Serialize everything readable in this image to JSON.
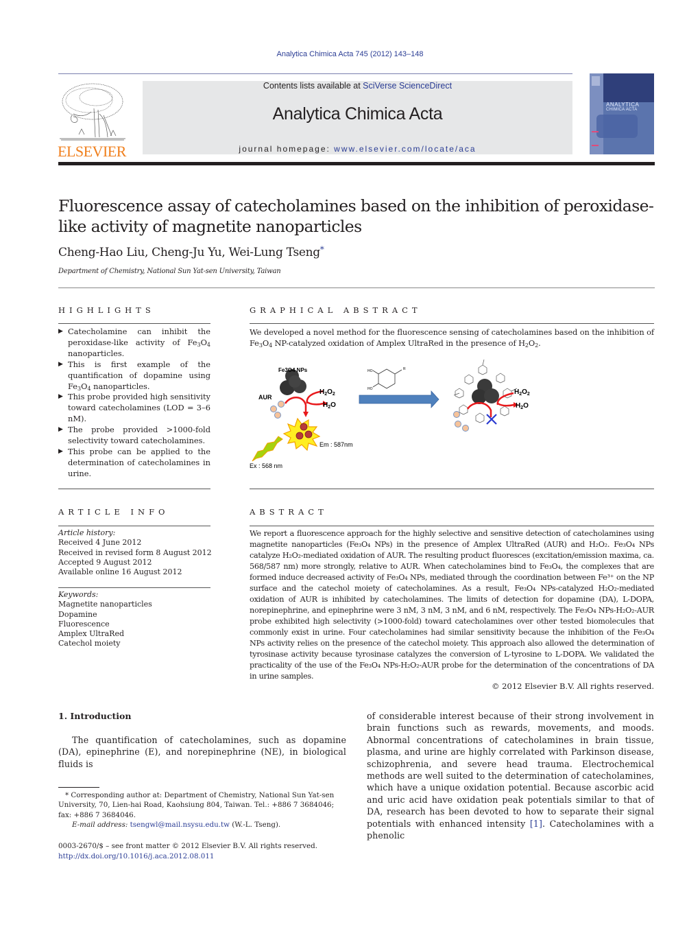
{
  "header": {
    "journal_ref": "Analytica Chimica Acta 745 (2012) 143–148",
    "contents_prefix": "Contents lists available at ",
    "contents_link": "SciVerse ScienceDirect",
    "journal_title": "Analytica Chimica Acta",
    "homepage_prefix": "journal homepage: ",
    "homepage_link": "www.elsevier.com/locate/aca",
    "publisher_logo_text": "ELSEVIER",
    "cover_title_line1": "ANALYTICA",
    "cover_title_line2": "CHIMICA ACTA"
  },
  "article": {
    "title": "Fluorescence assay of catecholamines based on the inhibition of peroxidase-like activity of magnetite nanoparticles",
    "authors": "Cheng-Hao Liu, Cheng-Ju Yu, Wei-Lung Tseng",
    "corresponding_mark": "*",
    "affiliation": "Department of Chemistry, National Sun Yat-sen University, Taiwan"
  },
  "highlights": {
    "heading": "HIGHLIGHTS",
    "items": [
      {
        "pre": "Catecholamine can inhibit the peroxidase-like activity of Fe",
        "s1": "3",
        "mid": "O",
        "s2": "4",
        "post": " nanoparticles."
      },
      {
        "pre": "This is first example of the quantification of dopamine using Fe",
        "s1": "3",
        "mid": "O",
        "s2": "4",
        "post": " nanoparticles."
      },
      {
        "pre": "This probe provided high sensitivity toward catecholamines (LOD = 3–6 nM).",
        "s1": "",
        "mid": "",
        "s2": "",
        "post": ""
      },
      {
        "pre": "The probe provided >1000-fold selectivity toward catecholamines.",
        "s1": "",
        "mid": "",
        "s2": "",
        "post": ""
      },
      {
        "pre": "This probe can be applied to the determination of catecholamines in urine.",
        "s1": "",
        "mid": "",
        "s2": "",
        "post": ""
      }
    ]
  },
  "graphical_abstract": {
    "heading": "GRAPHICAL ABSTRACT",
    "text_a": "We developed a novel method for the fluorescence sensing of catecholamines based on the inhibition of Fe",
    "text_b": " NP-catalyzed oxidation of Amplex UltraRed in the presence of H",
    "text_c": ".",
    "figure": {
      "np_label": "Fe3O4 NPs",
      "aur_label": "AUR",
      "h2o2_label": "H2O2",
      "h2o_label": "H2O",
      "em_label": "Em : 587nm",
      "ex_label": "Ex : 568 nm",
      "catechol_ho1": "HO",
      "catechol_ho2": "HO",
      "catechol_r": "R"
    }
  },
  "article_info": {
    "heading": "ARTICLE INFO",
    "history_label": "Article history:",
    "history": [
      "Received 4 June 2012",
      "Received in revised form 8 August 2012",
      "Accepted 9 August 2012",
      "Available online 16 August 2012"
    ],
    "keywords_label": "Keywords:",
    "keywords": [
      "Magnetite nanoparticles",
      "Dopamine",
      "Fluorescence",
      "Amplex UltraRed",
      "Catechol moiety"
    ]
  },
  "abstract": {
    "heading": "ABSTRACT",
    "text": "We report a fluorescence approach for the highly selective and sensitive detection of catecholamines using magnetite nanoparticles (Fe₃O₄ NPs) in the presence of Amplex UltraRed (AUR) and H₂O₂. Fe₃O₄ NPs catalyze H₂O₂-mediated oxidation of AUR. The resulting product fluoresces (excitation/emission maxima, ca. 568/587 nm) more strongly, relative to AUR. When catecholamines bind to Fe₃O₄, the complexes that are formed induce decreased activity of Fe₃O₄ NPs, mediated through the coordination between Fe³⁺ on the NP surface and the catechol moiety of catecholamines. As a result, Fe₃O₄ NPs-catalyzed H₂O₂-mediated oxidation of AUR is inhibited by catecholamines. The limits of detection for dopamine (DA), L-DOPA, norepinephrine, and epinephrine were 3 nM, 3 nM, 3 nM, and 6 nM, respectively. The Fe₃O₄ NPs-H₂O₂-AUR probe exhibited high selectivity (>1000-fold) toward catecholamines over other tested biomolecules that commonly exist in urine. Four catecholamines had similar sensitivity because the inhibition of the Fe₃O₄ NPs activity relies on the presence of the catechol moiety. This approach also allowed the determination of tyrosinase activity because tyrosinase catalyzes the conversion of L-tyrosine to L-DOPA. We validated the practicality of the use of the Fe₃O₄ NPs-H₂O₂-AUR probe for the determination of the concentrations of DA in urine samples.",
    "copyright": "© 2012 Elsevier B.V. All rights reserved."
  },
  "introduction": {
    "heading": "1.  Introduction",
    "para1": "The quantification of catecholamines, such as dopamine (DA), epinephrine (E), and norepinephrine (NE), in biological fluids is",
    "para2_pre": "of considerable interest because of their strong involvement in brain functions such as rewards, movements, and moods. Abnormal concentrations of catecholamines in brain tissue, plasma, and urine are highly correlated with Parkinson disease, schizophrenia, and severe head trauma. Electrochemical methods are well suited to the determination of catecholamines, which have a unique oxidation potential. Because ascorbic acid and uric acid have oxidation peak potentials similar to that of DA, research has been devoted to how to separate their signal potentials with enhanced intensity ",
    "para2_ref": "[1]",
    "para2_post": ". Catecholamines with a phenolic"
  },
  "footnote": {
    "corresponding": "* Corresponding author at: Department of Chemistry, National Sun Yat-sen University, 70, Lien-hai Road, Kaohsiung 804, Taiwan. Tel.: +886 7 3684046; fax: +886 7 3684046.",
    "email_label": "E-mail address: ",
    "email": "tsengwl@mail.nsysu.edu.tw",
    "email_suffix": " (W.-L. Tseng).",
    "front_matter": "0003-2670/$ – see front matter © 2012 Elsevier B.V. All rights reserved.",
    "doi": "http://dx.doi.org/10.1016/j.aca.2012.08.011"
  },
  "colors": {
    "link": "#2a3c94",
    "elsevier_orange": "#f07f1c",
    "masthead_bg": "#e6e7e8",
    "arrow_blue": "#4f81bd",
    "reaction_red": "#e8191c"
  }
}
